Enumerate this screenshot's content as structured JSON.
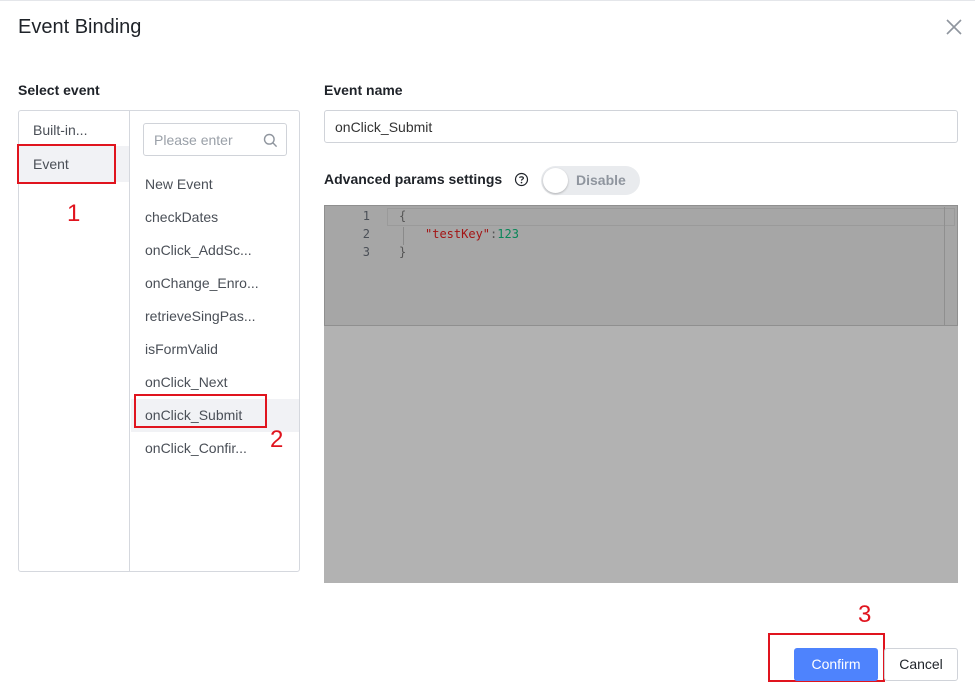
{
  "dialog": {
    "title": "Event Binding"
  },
  "select_event": {
    "label": "Select event",
    "categories": [
      {
        "label": "Built-in..."
      },
      {
        "label": "Event",
        "selected": true
      }
    ],
    "search": {
      "placeholder": "Please enter",
      "value": ""
    },
    "events": [
      {
        "label": "New Event"
      },
      {
        "label": "checkDates"
      },
      {
        "label": "onClick_AddSc..."
      },
      {
        "label": "onChange_Enro..."
      },
      {
        "label": "retrieveSingPas..."
      },
      {
        "label": "isFormValid"
      },
      {
        "label": "onClick_Next"
      },
      {
        "label": "onClick_Submit",
        "selected": true
      },
      {
        "label": "onClick_Confir..."
      }
    ]
  },
  "event_name": {
    "label": "Event name",
    "value": "onClick_Submit"
  },
  "advanced": {
    "label": "Advanced params settings",
    "toggle_text": "Disable",
    "enabled": false
  },
  "editor": {
    "line_numbers": [
      "1",
      "2",
      "3"
    ],
    "lines": [
      {
        "text": "{"
      },
      {
        "key": "\"testKey\"",
        "sep": ":",
        "value": "123"
      },
      {
        "text": "}"
      }
    ]
  },
  "annotations": [
    "1",
    "2",
    "3"
  ],
  "footer": {
    "confirm_label": "Confirm",
    "cancel_label": "Cancel"
  },
  "colors": {
    "primary": "#4e83fd",
    "annotation": "#e0141e",
    "selected_bg": "#f1f2f5"
  }
}
